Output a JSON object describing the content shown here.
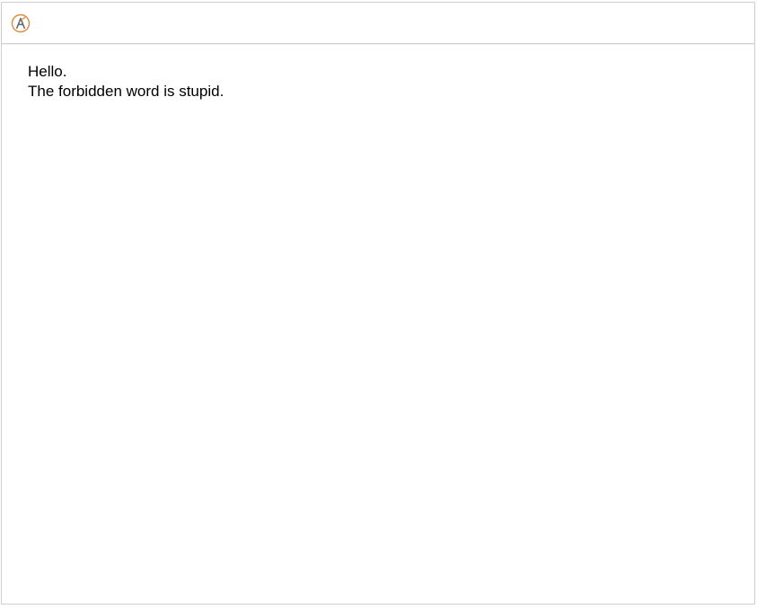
{
  "toolbar": {
    "icon": "accessibility-a-icon",
    "icon_color": "#e08a3c"
  },
  "content": {
    "lines": [
      "Hello.",
      "The forbidden word is stupid."
    ]
  }
}
